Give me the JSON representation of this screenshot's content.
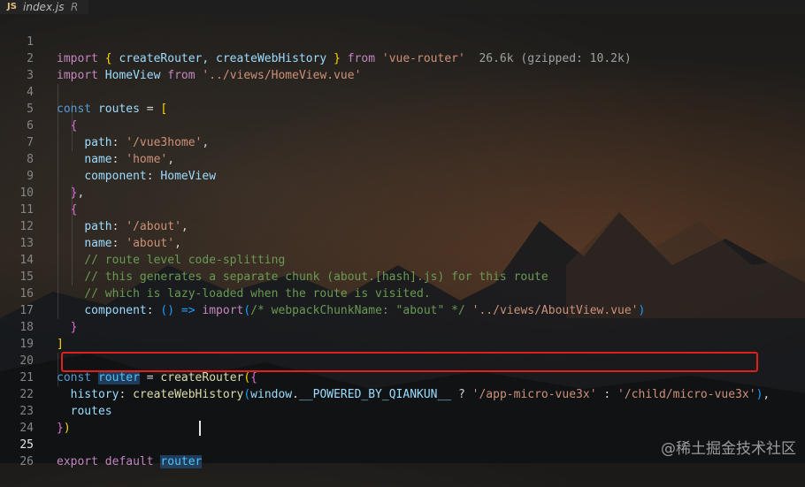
{
  "tab": {
    "icon": "JS",
    "filename": "index.js",
    "status": "R"
  },
  "lines": [
    {
      "n": "1"
    },
    {
      "n": "2"
    },
    {
      "n": "3"
    },
    {
      "n": "4"
    },
    {
      "n": "5"
    },
    {
      "n": "6"
    },
    {
      "n": "7"
    },
    {
      "n": "8"
    },
    {
      "n": "9"
    },
    {
      "n": "10"
    },
    {
      "n": "11"
    },
    {
      "n": "12"
    },
    {
      "n": "13"
    },
    {
      "n": "14"
    },
    {
      "n": "15"
    },
    {
      "n": "16"
    },
    {
      "n": "17"
    },
    {
      "n": "18"
    },
    {
      "n": "19"
    },
    {
      "n": "20"
    },
    {
      "n": "21"
    },
    {
      "n": "22"
    },
    {
      "n": "23"
    },
    {
      "n": "24"
    },
    {
      "n": "25"
    },
    {
      "n": "26"
    }
  ],
  "code": {
    "l1": {
      "import": "import",
      "ob": "{",
      "names": " createRouter, createWebHistory ",
      "cb": "}",
      "from": "from",
      "mod": "'vue-router'",
      "hint": "26.6k (gzipped: 10.2k)"
    },
    "l2": {
      "import": "import",
      "name": "HomeView",
      "from": "from",
      "mod": "'../views/HomeView.vue'"
    },
    "l4": {
      "const": "const",
      "name": "routes",
      "eq": " = ",
      "ob": "["
    },
    "l5": {
      "ob": "{"
    },
    "l6": {
      "key": "path",
      "val": "'/vue3home'"
    },
    "l7": {
      "key": "name",
      "val": "'home'"
    },
    "l8": {
      "key": "component",
      "val": "HomeView"
    },
    "l9": {
      "cb": "}",
      "comma": ","
    },
    "l10": {
      "ob": "{"
    },
    "l11": {
      "key": "path",
      "val": "'/about'"
    },
    "l12": {
      "key": "name",
      "val": "'about'"
    },
    "l13": {
      "comment": "// route level code-splitting"
    },
    "l14": {
      "comment": "// this generates a separate chunk (about.[hash].js) for this route"
    },
    "l15": {
      "comment": "// which is lazy-loaded when the route is visited."
    },
    "l16": {
      "key": "component",
      "arrow": "() => ",
      "fn": "import",
      "op": "(",
      "comment": "/* webpackChunkName: \"about\" */",
      "val": "'../views/AboutView.vue'",
      "cp": ")"
    },
    "l17": {
      "cb": "}"
    },
    "l18": {
      "cb": "]"
    },
    "l20": {
      "const": "const",
      "name": "router",
      "eq": " = ",
      "fn": "createRouter",
      "op": "(",
      "ob": "{"
    },
    "l21": {
      "key": "history",
      "fn": "createWebHistory",
      "op": "(",
      "obj": "window",
      "prop": "__POWERED_BY_QIANKUN__",
      "q": " ? ",
      "v1": "'/app-micro-vue3x'",
      "c": " : ",
      "v2": "'/child/micro-vue3x'",
      "cp": ")",
      "comma": ","
    },
    "l22": {
      "name": "routes"
    },
    "l23": {
      "cb": "}",
      "cp": ")"
    },
    "l25": {
      "export": "export",
      "default": "default",
      "name": "router"
    }
  },
  "watermark": "@稀土掘金技术社区",
  "colors": {
    "highlight_box": "#e0201b"
  }
}
